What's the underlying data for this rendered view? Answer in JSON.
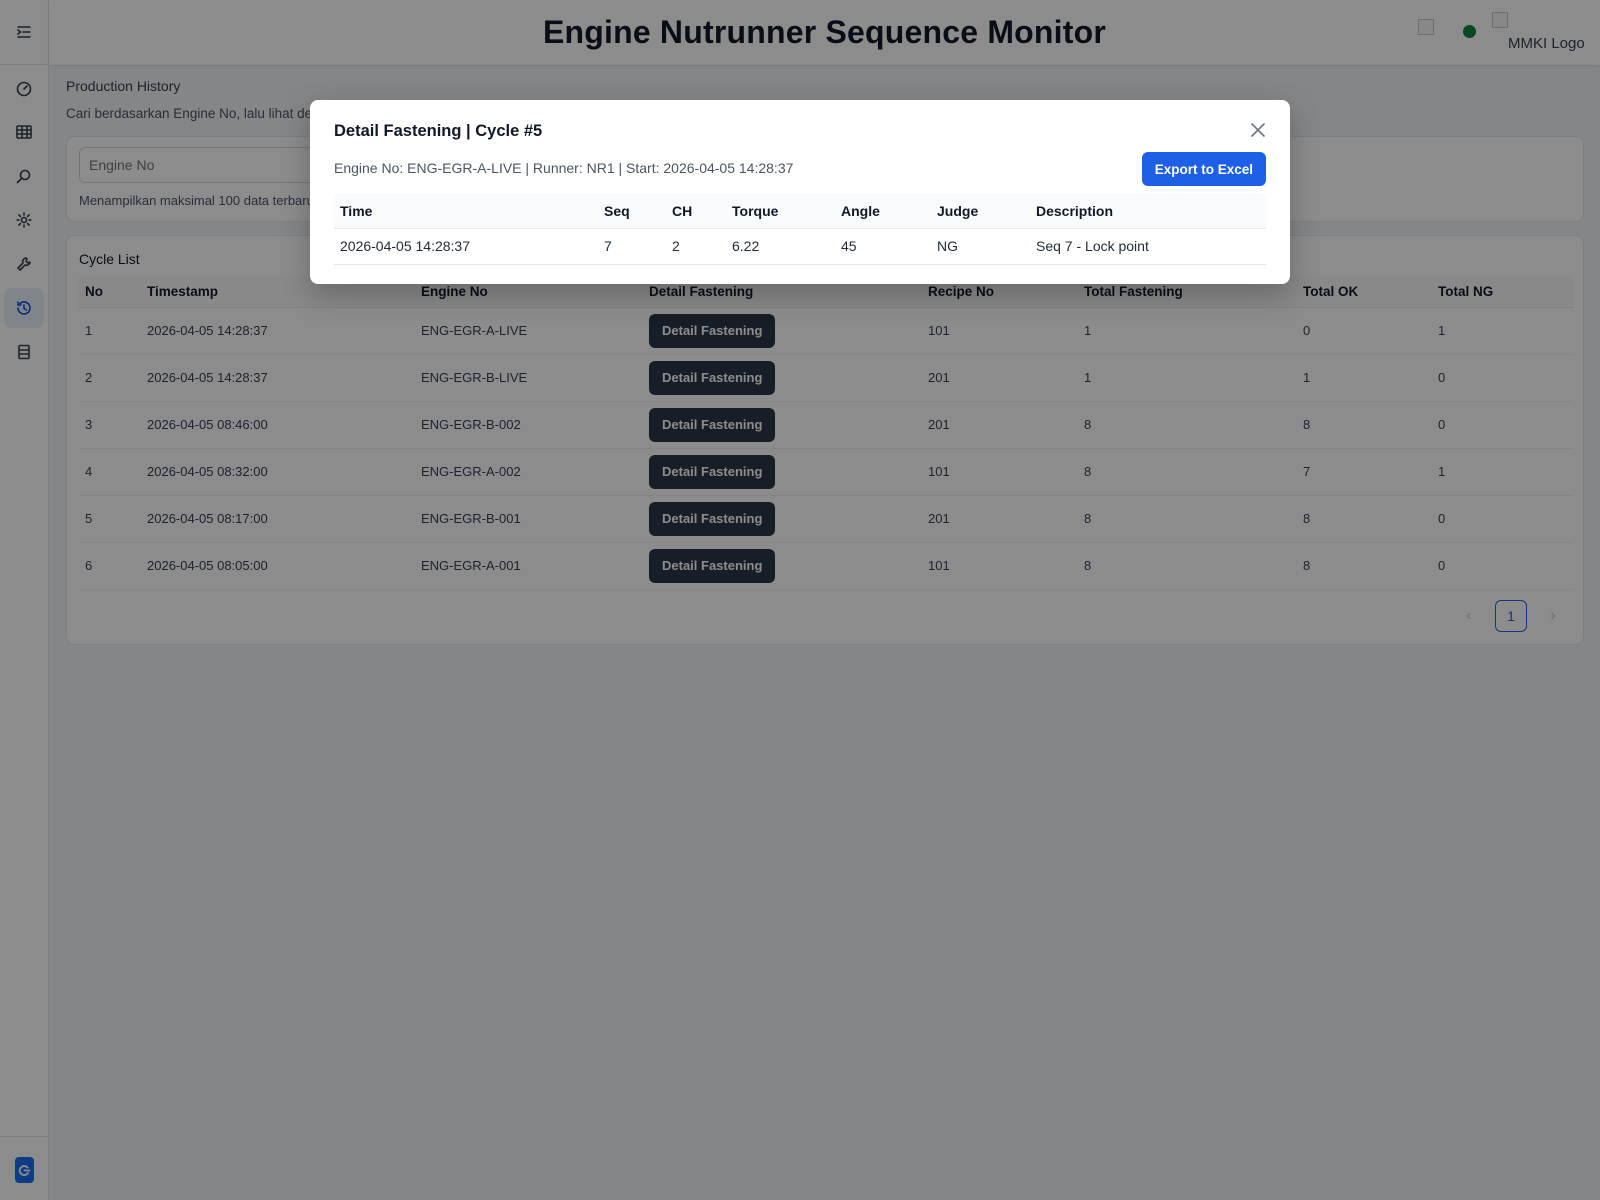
{
  "app": {
    "title": "Engine Nutrunner Sequence Monitor",
    "logo_alt": "MMKI Logo"
  },
  "sidebar": {
    "items": [
      {
        "icon": "menu-toggle-icon",
        "active": false
      },
      {
        "icon": "dashboard-gauge-icon",
        "active": false
      },
      {
        "icon": "table-grid-icon",
        "active": false
      },
      {
        "icon": "search-icon",
        "active": false
      },
      {
        "icon": "gear-icon",
        "active": false
      },
      {
        "icon": "wrench-icon",
        "active": false
      },
      {
        "icon": "history-clock-icon",
        "active": true
      },
      {
        "icon": "database-icon",
        "active": false
      }
    ],
    "footer_icon": "logout-icon"
  },
  "page": {
    "subtitle": "Production History",
    "description": "Cari berdasarkan Engine No, lalu lihat deta",
    "search": {
      "placeholder": "Engine No",
      "note": "Menampilkan maksimal 100 data terbaru"
    },
    "cycle_list": {
      "title": "Cycle List",
      "columns": [
        "No",
        "Timestamp",
        "Engine No",
        "Detail Fastening",
        "Recipe No",
        "Total Fastening",
        "Total OK",
        "Total NG"
      ],
      "button_label": "Detail Fastening",
      "rows": [
        {
          "no": "1",
          "timestamp": "2026-04-05 14:28:37",
          "engine_no": "ENG-EGR-A-LIVE",
          "recipe_no": "101",
          "total_fastening": "1",
          "total_ok": "0",
          "total_ng": "1"
        },
        {
          "no": "2",
          "timestamp": "2026-04-05 14:28:37",
          "engine_no": "ENG-EGR-B-LIVE",
          "recipe_no": "201",
          "total_fastening": "1",
          "total_ok": "1",
          "total_ng": "0"
        },
        {
          "no": "3",
          "timestamp": "2026-04-05 08:46:00",
          "engine_no": "ENG-EGR-B-002",
          "recipe_no": "201",
          "total_fastening": "8",
          "total_ok": "8",
          "total_ng": "0"
        },
        {
          "no": "4",
          "timestamp": "2026-04-05 08:32:00",
          "engine_no": "ENG-EGR-A-002",
          "recipe_no": "101",
          "total_fastening": "8",
          "total_ok": "7",
          "total_ng": "1"
        },
        {
          "no": "5",
          "timestamp": "2026-04-05 08:17:00",
          "engine_no": "ENG-EGR-B-001",
          "recipe_no": "201",
          "total_fastening": "8",
          "total_ok": "8",
          "total_ng": "0"
        },
        {
          "no": "6",
          "timestamp": "2026-04-05 08:05:00",
          "engine_no": "ENG-EGR-A-001",
          "recipe_no": "101",
          "total_fastening": "8",
          "total_ok": "8",
          "total_ng": "0"
        }
      ],
      "pagination": {
        "current_page": "1",
        "prev": "‹",
        "next": "›"
      }
    }
  },
  "modal": {
    "title": "Detail Fastening | Cycle #5",
    "meta": "Engine No: ENG-EGR-A-LIVE | Runner: NR1 | Start: 2026-04-05 14:28:37",
    "export_label": "Export to Excel",
    "columns": [
      "Time",
      "Seq",
      "CH",
      "Torque",
      "Angle",
      "Judge",
      "Description"
    ],
    "rows": [
      {
        "time": "2026-04-05 14:28:37",
        "seq": "7",
        "ch": "2",
        "torque": "6.22",
        "angle": "45",
        "judge": "NG",
        "description": "Seq 7 - Lock point"
      }
    ]
  },
  "colors": {
    "accent": "#1d5fe6",
    "status_online": "#15803d",
    "button_dark": "#2d3748"
  }
}
